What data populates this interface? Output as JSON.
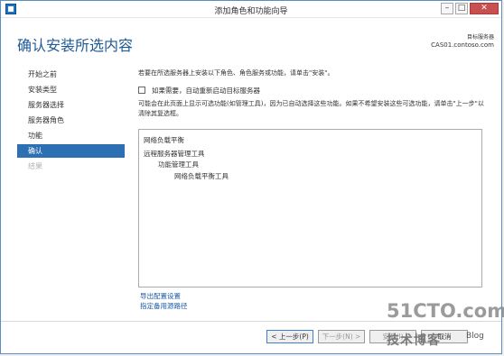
{
  "window": {
    "title": "添加角色和功能向导",
    "controls": {
      "minimize": "–",
      "maximize": "□",
      "close": "✕"
    }
  },
  "header": {
    "page_title": "确认安装所选内容",
    "server_label": "目标服务器",
    "server_name": "CAS01.contoso.com"
  },
  "nav": {
    "items": [
      {
        "label": "开始之前"
      },
      {
        "label": "安装类型"
      },
      {
        "label": "服务器选择"
      },
      {
        "label": "服务器角色"
      },
      {
        "label": "功能"
      },
      {
        "label": "确认"
      },
      {
        "label": "结果"
      }
    ],
    "active_index": 5
  },
  "main": {
    "intro": "若要在所选服务器上安装以下角色、角色服务或功能，请单击\"安装\"。",
    "restart_checkbox": {
      "label": "如果需要，自动重新启动目标服务器",
      "checked": false
    },
    "note": "可能会在此页面上显示可选功能(如管理工具)，因为已自动选择这些功能。如果不希望安装这些可选功能，请单击\"上一步\"以清除其复选框。",
    "features": [
      "网络负载平衡",
      "远程服务器管理工具",
      "功能管理工具",
      "网络负载平衡工具"
    ],
    "links": {
      "export": "导出配置设置",
      "alternate_source": "指定备用源路径"
    }
  },
  "footer": {
    "prev": "< 上一步(P)",
    "next": "下一步(N) >",
    "install": "安装(I)",
    "cancel": "取消"
  },
  "watermark": {
    "site": "51CTO.com",
    "blog": "技术博客",
    "blog_en": "Blog"
  },
  "colors": {
    "accent": "#2c6fb3",
    "title": "#1e5a96",
    "link": "#1a5aa6"
  }
}
